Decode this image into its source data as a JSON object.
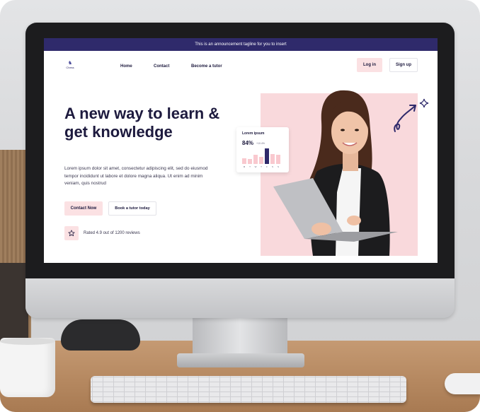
{
  "announcement": "This is an announcement tagline for you to insert",
  "logo": {
    "text": "Chess"
  },
  "nav": {
    "links": [
      "Home",
      "Contact",
      "Become a tutor"
    ],
    "login_label": "Log in",
    "signup_label": "Sign up"
  },
  "hero": {
    "headline_line1": "A new way to learn &",
    "headline_line2": "get knowledge",
    "body": "Lorem ipsum dolor sit amet, consectetur adipiscing elit, sed do eiusmod tempor incididunt ut labore et dolore magna aliqua. Ut enim ad minim veniam, quis nostrud",
    "contact_button": "Contact Now",
    "book_button": "Book a tutor today",
    "rating_text": "Rated 4.9 out of 1200 reviews"
  },
  "stat_card": {
    "title": "Lorem ipsum",
    "value": "84%",
    "delta": "+10.4%",
    "days": [
      "M",
      "T",
      "W",
      "T",
      "F",
      "S",
      "S"
    ],
    "bar_levels": [
      0.35,
      0.3,
      0.6,
      0.45,
      1.0,
      0.65,
      0.6
    ]
  },
  "colors": {
    "brand": "#2f2a6b",
    "accent_pink": "#fbe1e3",
    "hero_bg": "#f9d9dc",
    "bar_highlight": "#2f2a6b"
  }
}
